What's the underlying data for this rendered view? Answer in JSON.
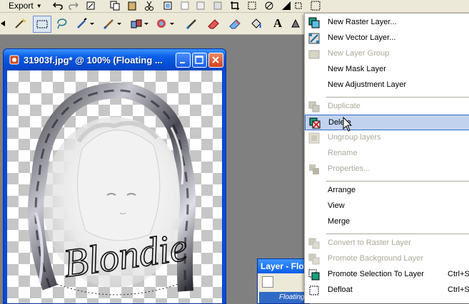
{
  "toolbar": {
    "export_label": "Export",
    "text_tool_glyph": "A"
  },
  "document": {
    "title": "31903f.jpg* @ 100% (Floating ...",
    "artwork_text": "Blondie"
  },
  "layer_palette": {
    "title": "Layer - Floa",
    "row_label": "Floating Selection"
  },
  "menu": {
    "items": [
      {
        "label": "New Raster Layer...",
        "icon": "raster-layer-icon",
        "enabled": true
      },
      {
        "label": "New Vector Layer...",
        "icon": "vector-layer-icon",
        "enabled": true
      },
      {
        "label": "New Layer Group",
        "icon": "layer-group-icon",
        "enabled": false
      },
      {
        "label": "New Mask Layer",
        "icon": "",
        "enabled": true
      },
      {
        "label": "New Adjustment Layer",
        "icon": "",
        "enabled": true
      },
      {
        "label": "Duplicate",
        "icon": "duplicate-icon",
        "enabled": false
      },
      {
        "label": "Delete",
        "icon": "delete-layer-icon",
        "enabled": true,
        "highlighted": true
      },
      {
        "label": "Ungroup layers",
        "icon": "ungroup-icon",
        "enabled": false
      },
      {
        "label": "Rename",
        "icon": "",
        "enabled": false
      },
      {
        "label": "Properties...",
        "icon": "properties-icon",
        "enabled": false
      },
      {
        "label": "Arrange",
        "icon": "",
        "enabled": true
      },
      {
        "label": "View",
        "icon": "",
        "enabled": true
      },
      {
        "label": "Merge",
        "icon": "",
        "enabled": true
      },
      {
        "label": "Convert to Raster Layer",
        "icon": "convert-raster-icon",
        "enabled": false
      },
      {
        "label": "Promote Background Layer",
        "icon": "promote-background-icon",
        "enabled": false
      },
      {
        "label": "Promote Selection To Layer",
        "icon": "promote-selection-icon",
        "enabled": true,
        "shortcut": "Ctrl+S"
      },
      {
        "label": "Defloat",
        "icon": "defloat-icon",
        "enabled": true,
        "shortcut": "Ctrl+S"
      }
    ]
  },
  "colors": {
    "xp_title_blue": "#0a5ee6",
    "menu_highlight": "#c1d2ee",
    "disabled_text": "#aca899"
  }
}
